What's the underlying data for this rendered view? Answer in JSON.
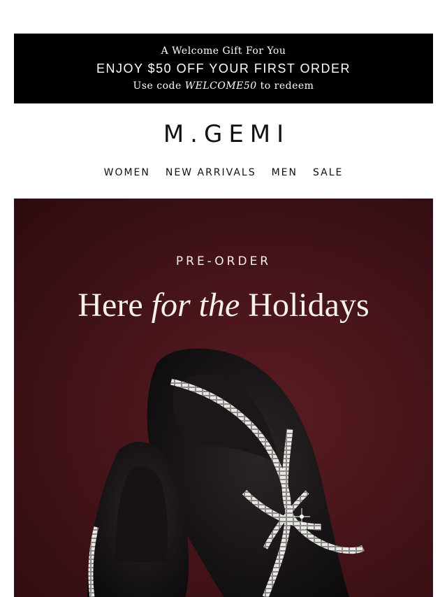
{
  "promo": {
    "line1": "A Welcome Gift For You",
    "line2": "ENJOY $50 OFF YOUR FIRST ORDER",
    "line3_prefix": "Use code ",
    "line3_code": "WELCOME50",
    "line3_suffix": " to redeem"
  },
  "brand": {
    "logo": "M.GEMI"
  },
  "nav": {
    "items": [
      "WOMEN",
      "NEW ARRIVALS",
      "MEN",
      "SALE"
    ]
  },
  "hero": {
    "eyebrow": "PRE-ORDER",
    "headline": {
      "part1": "Here ",
      "italic": "for the",
      "part2": " Holidays"
    },
    "background_color": "#46141a"
  }
}
